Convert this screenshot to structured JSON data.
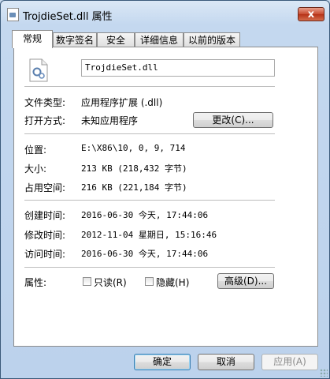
{
  "window": {
    "title": "TrojdieSet.dll 属性",
    "close_label": "x"
  },
  "tabs": [
    {
      "label": "常规",
      "active": true
    },
    {
      "label": "数字签名"
    },
    {
      "label": "安全"
    },
    {
      "label": "详细信息"
    },
    {
      "label": "以前的版本"
    }
  ],
  "general": {
    "filename": "TrojdieSet.dll",
    "file_type_label": "文件类型:",
    "file_type_value": "应用程序扩展 (.dll)",
    "opens_with_label": "打开方式:",
    "opens_with_value": "未知应用程序",
    "change_button": "更改(C)...",
    "location_label": "位置:",
    "location_value": "E:\\X86\\10, 0, 9, 714",
    "size_label": "大小:",
    "size_value": "213 KB (218,432 字节)",
    "size_on_disk_label": "占用空间:",
    "size_on_disk_value": "216 KB (221,184 字节)",
    "created_label": "创建时间:",
    "created_value": "2016-06-30 今天, 17:44:06",
    "modified_label": "修改时间:",
    "modified_value": "2012-11-04 星期日, 15:16:46",
    "accessed_label": "访问时间:",
    "accessed_value": "2016-06-30 今天, 17:44:06",
    "attributes_label": "属性:",
    "readonly_label": "只读(R)",
    "hidden_label": "隐藏(H)",
    "advanced_button": "高级(D)..."
  },
  "footer": {
    "ok": "确定",
    "cancel": "取消",
    "apply": "应用(A)"
  }
}
